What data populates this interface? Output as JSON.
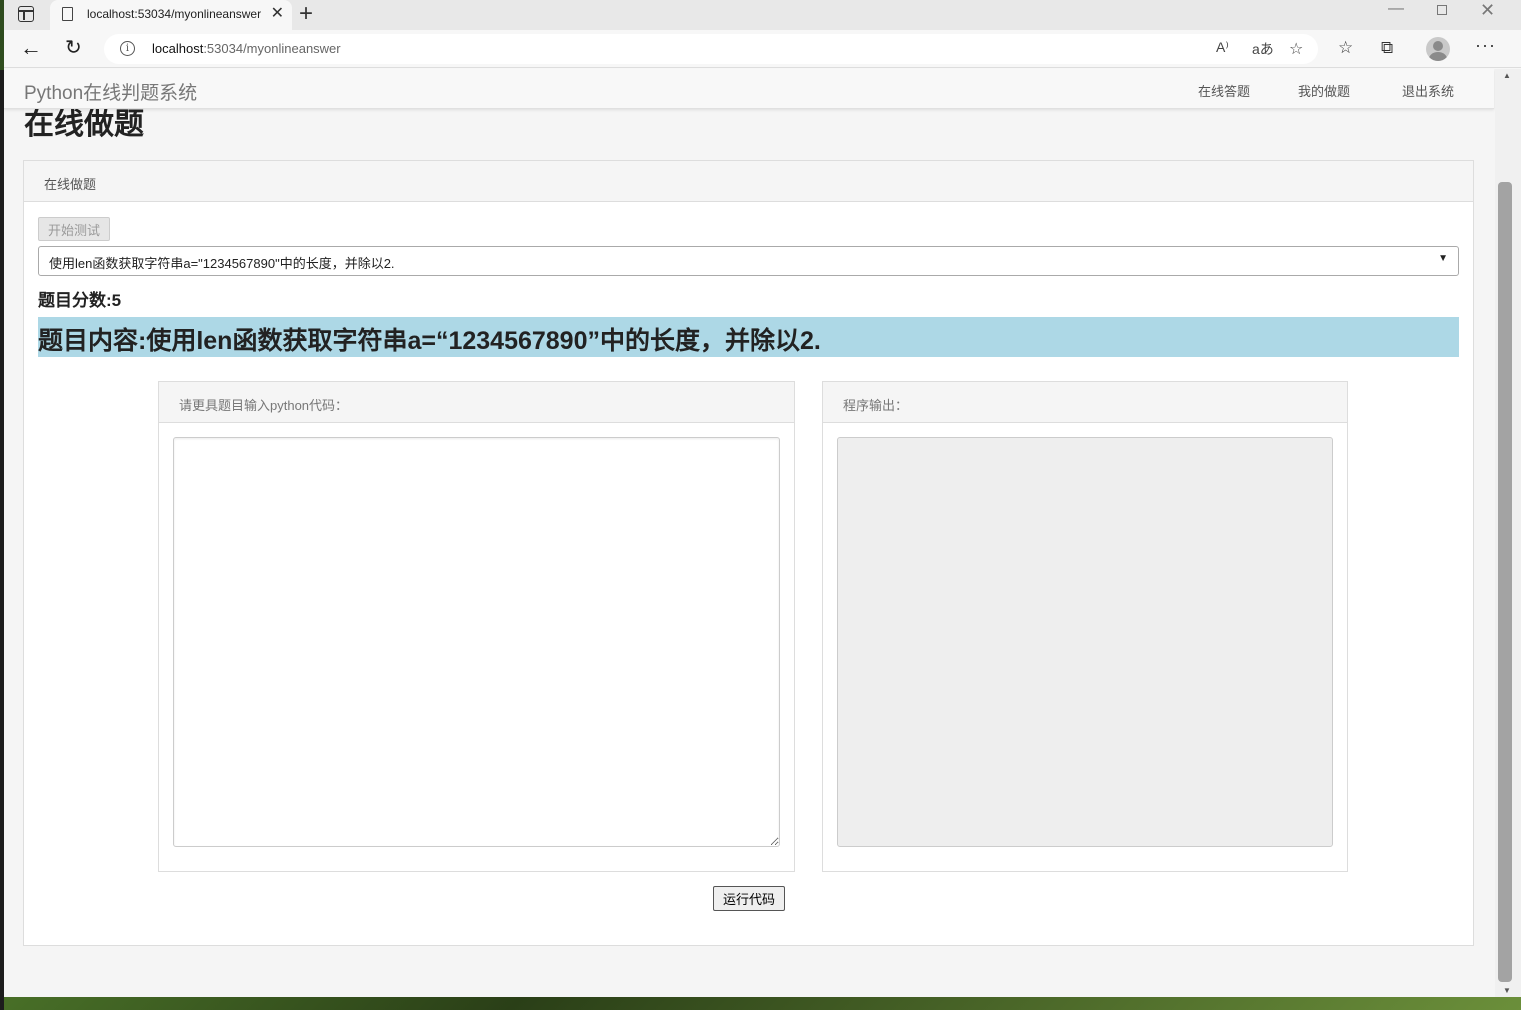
{
  "browser": {
    "tab_title": "localhost:53034/myonlineanswer",
    "tab_close": "✕",
    "new_tab": "+",
    "url_host": "localhost",
    "url_rest": ":53034/myonlineanswer",
    "window_min": "—",
    "window_close": "✕"
  },
  "navbar": {
    "brand": "Python在线判题系统",
    "links": [
      "在线答题",
      "我的做题",
      "退出系统"
    ]
  },
  "page": {
    "heading": "在线做题"
  },
  "panel": {
    "heading": "在线做题",
    "start_button": "开始测试",
    "selected_question": "使用len函数获取字符串a=\"1234567890\"中的长度，并除以2.",
    "score": "题目分数:5",
    "content": "题目内容:使用len函数获取字符串a=“1234567890”中的长度，并除以2.",
    "content_bg": "#add8e6"
  },
  "code_panel": {
    "heading": "请更具题目输入python代码：",
    "value": ""
  },
  "output_panel": {
    "heading": "程序输出：",
    "value": ""
  },
  "run_button": "运行代码",
  "icons": [
    "sidebar-toggle-icon",
    "page-icon",
    "back-arrow-icon",
    "reload-icon",
    "info-icon",
    "read-aloud-icon",
    "translate-icon",
    "add-favorite-icon",
    "favorites-icon",
    "collections-icon",
    "profile-avatar-icon",
    "more-menu-icon"
  ]
}
